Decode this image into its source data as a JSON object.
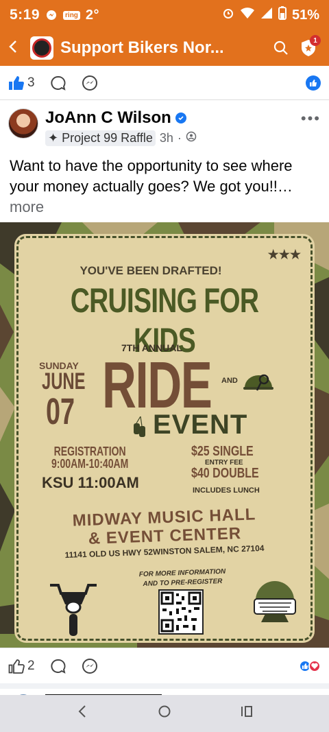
{
  "status_bar": {
    "time": "5:19",
    "ring_label": "ring",
    "temperature": "2°",
    "battery": "51%"
  },
  "app_bar": {
    "title": "Support Bikers Nor...",
    "notification_count": "1"
  },
  "previous_post_bar": {
    "like_count": "3"
  },
  "post": {
    "author": "JoAnn C Wilson",
    "group_tag": "Project 99 Raffle",
    "time": "3h",
    "text": "Want to have the opportunity to see where your money actually goes? We got you!!…",
    "more_label": "more",
    "like_count": "2"
  },
  "flyer": {
    "drafted": "YOU'VE BEEN DRAFTED!",
    "headline": "CRUISING FOR KIDS",
    "annual": "7TH ANNUAL",
    "day": "SUNDAY",
    "month": "JUNE",
    "date": "07",
    "ride": "RIDE",
    "and": "AND",
    "event": "EVENT",
    "registration": "REGISTRATION",
    "registration_time": "9:00AM-10:40AM",
    "ksu": "KSU 11:00AM",
    "price_single": "$25 SINGLE",
    "entry_fee": "ENTRY FEE",
    "price_double": "$40 DOUBLE",
    "lunch": "INCLUDES LUNCH",
    "venue_line1": "MIDWAY MUSIC HALL",
    "venue_line2": "& EVENT CENTER",
    "address": "11141 OLD US HWY 52WINSTON SALEM, NC 27104",
    "more_info_line1": "FOR MORE INFORMATION",
    "more_info_line2": "AND TO PRE-REGISTER"
  },
  "colors": {
    "accent": "#e2711d",
    "facebook_blue": "#1877f2",
    "flyer_bg": "#e2d3a4",
    "olive": "#4b5a25",
    "brown": "#744e37"
  }
}
